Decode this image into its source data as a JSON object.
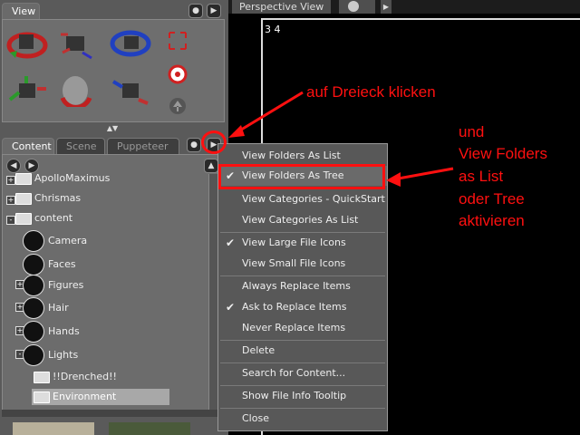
{
  "view_panel": {
    "tab_label": "View"
  },
  "lower_tabs": [
    "Content",
    "Scene",
    "Puppeteer"
  ],
  "tree": {
    "items": [
      {
        "label": "ApolloMaximus",
        "kind": "folder",
        "expander": "+"
      },
      {
        "label": "Chrismas",
        "kind": "folder",
        "expander": "+"
      },
      {
        "label": "content",
        "kind": "folder",
        "expander": "-"
      },
      {
        "label": "Camera",
        "kind": "round"
      },
      {
        "label": "Faces",
        "kind": "round"
      },
      {
        "label": "Figures",
        "kind": "round",
        "expander": "+"
      },
      {
        "label": "Hair",
        "kind": "round",
        "expander": "+"
      },
      {
        "label": "Hands",
        "kind": "round",
        "expander": "+"
      },
      {
        "label": "Lights",
        "kind": "round",
        "expander": "-"
      },
      {
        "label": "!!Drenched!!",
        "kind": "folder"
      },
      {
        "label": "Environment",
        "kind": "folder",
        "selected": true
      }
    ]
  },
  "viewport": {
    "tab_label": "Perspective View",
    "overlay_text": "3 4"
  },
  "menu": {
    "items": [
      {
        "label": "View Folders As List",
        "checked": false
      },
      {
        "label": "View Folders As Tree",
        "checked": true,
        "highlighted": true
      },
      {
        "label": "View Categories - QuickStart",
        "checked": false
      },
      {
        "label": "View Categories As List",
        "checked": false
      },
      {
        "label": "View Large File Icons",
        "checked": true
      },
      {
        "label": "View Small File Icons",
        "checked": false
      },
      {
        "label": "Always Replace Items",
        "checked": false
      },
      {
        "label": "Ask to Replace Items",
        "checked": true
      },
      {
        "label": "Never Replace Items",
        "checked": false
      },
      {
        "label": "Delete",
        "checked": false
      },
      {
        "label": "Search for Content...",
        "checked": false
      },
      {
        "label": "Show File Info Tooltip",
        "checked": false
      },
      {
        "label": "Close",
        "checked": false
      }
    ],
    "check_glyph": "✔"
  },
  "annotations": {
    "click_triangle": "auf Dreieck klicken",
    "activate": [
      "und",
      "View Folders",
      "as List",
      "oder Tree",
      "aktivieren"
    ]
  },
  "colors": {
    "annotation": "#ff1010",
    "panel": "#6c6c6c",
    "background": "#000000"
  }
}
